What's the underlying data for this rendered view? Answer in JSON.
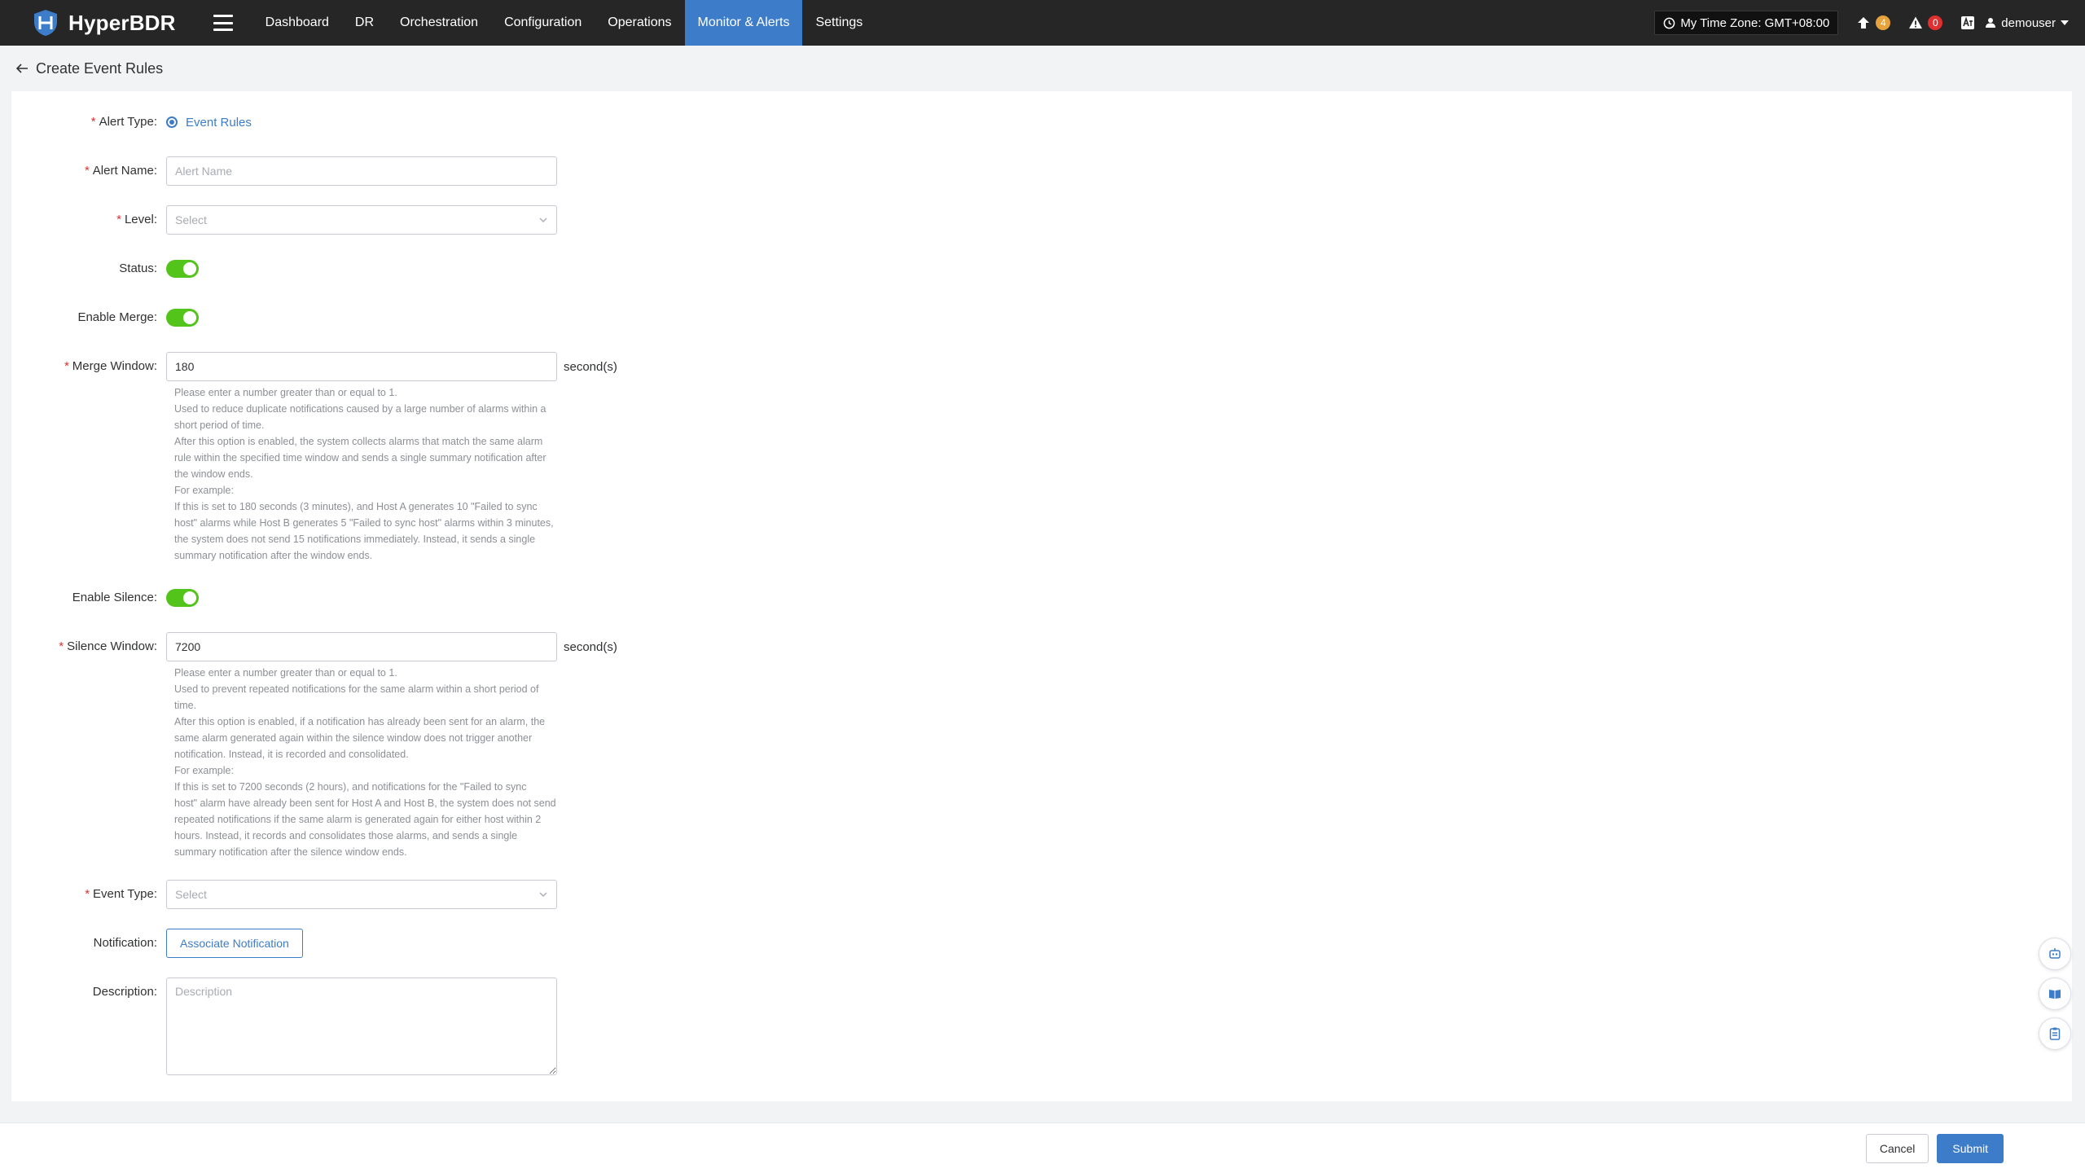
{
  "app": {
    "name": "HyperBDR",
    "nav": [
      "Dashboard",
      "DR",
      "Orchestration",
      "Configuration",
      "Operations",
      "Monitor & Alerts",
      "Settings"
    ],
    "active_nav": "Monitor & Alerts",
    "timezone": "My Time Zone: GMT+08:00",
    "upgrade_count": "4",
    "alert_count": "0",
    "user": "demouser"
  },
  "page": {
    "title": "Create Event Rules"
  },
  "form": {
    "alert_type": {
      "label": "Alert Type:",
      "value": "Event Rules"
    },
    "alert_name": {
      "label": "Alert Name:",
      "placeholder": "Alert Name",
      "value": ""
    },
    "level": {
      "label": "Level:",
      "placeholder": "Select"
    },
    "status": {
      "label": "Status:",
      "on": true
    },
    "enable_merge": {
      "label": "Enable Merge:",
      "on": true
    },
    "merge_window": {
      "label": "Merge Window:",
      "value": "180",
      "unit": "second(s)",
      "help": [
        "Please enter a number greater than or equal to 1.",
        "Used to reduce duplicate notifications caused by a large number of alarms within a",
        "short period of time.",
        "After this option is enabled, the system collects alarms that match the same alarm",
        "rule within the specified time window and sends a single summary notification after",
        "the window ends.",
        "For example:",
        "If this is set to 180 seconds (3 minutes), and Host A generates 10 \"Failed to sync",
        "host\" alarms while Host B generates 5 \"Failed to sync host\" alarms within 3 minutes,",
        "the system does not send 15 notifications immediately. Instead, it sends a single",
        "summary notification after the window ends."
      ]
    },
    "enable_silence": {
      "label": "Enable Silence:",
      "on": true
    },
    "silence_window": {
      "label": "Silence Window:",
      "value": "7200",
      "unit": "second(s)",
      "help": [
        "Please enter a number greater than or equal to 1.",
        "Used to prevent repeated notifications for the same alarm within a short period of",
        "time.",
        "After this option is enabled, if a notification has already been sent for an alarm, the",
        "same alarm generated again within the silence window does not trigger another",
        "notification. Instead, it is recorded and consolidated.",
        "For example:",
        "If this is set to 7200 seconds (2 hours), and notifications for the \"Failed to sync",
        "host\" alarm have already been sent for Host A and Host B, the system does not send",
        "repeated notifications if the same alarm is generated again for either host within 2",
        "hours. Instead, it records and consolidates those alarms, and sends a single",
        "summary notification after the silence window ends."
      ]
    },
    "event_type": {
      "label": "Event Type:",
      "placeholder": "Select"
    },
    "notification": {
      "label": "Notification:",
      "button": "Associate Notification"
    },
    "description": {
      "label": "Description:",
      "placeholder": "Description"
    }
  },
  "footer": {
    "cancel": "Cancel",
    "submit": "Submit"
  },
  "colors": {
    "topbar": "#262626",
    "accent": "#3d7cc9",
    "switch_on": "#52c41a",
    "required": "#e0302f"
  }
}
